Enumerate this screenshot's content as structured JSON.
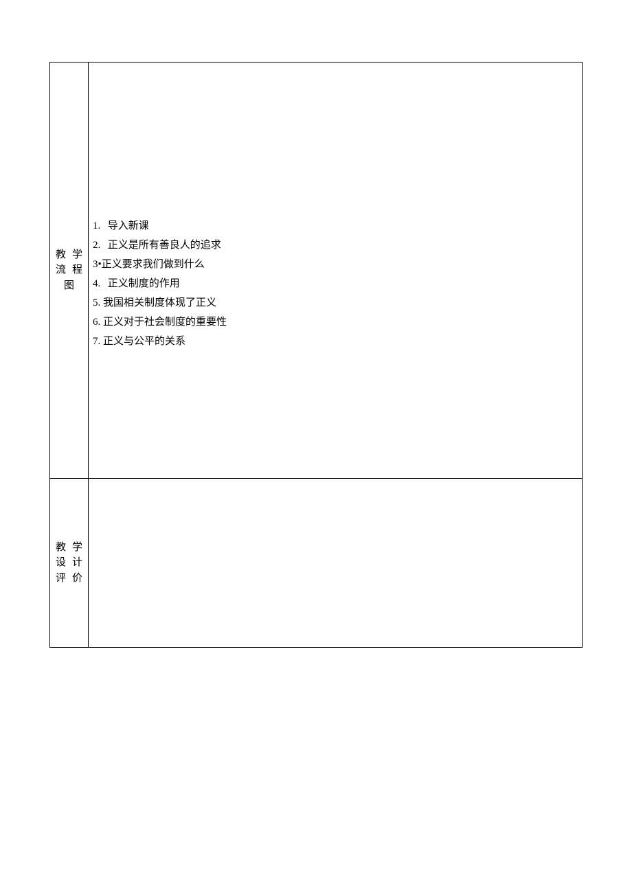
{
  "rows": [
    {
      "label": {
        "line1_a": "教",
        "line1_b": "学",
        "line2_a": "流",
        "line2_b": "程",
        "line3": "图"
      },
      "items": [
        {
          "num": "1.",
          "text": "导入新课",
          "padded": true
        },
        {
          "num": "2.",
          "text": "正义是所有善良人的追求",
          "padded": true
        },
        {
          "num": "3•",
          "text": "正义要求我们做到什么",
          "padded": false
        },
        {
          "num": "4.",
          "text": "正义制度的作用",
          "padded": true
        },
        {
          "num": "5.",
          "text": "我国相关制度体现了正义",
          "padded": false
        },
        {
          "num": "6.",
          "text": "正义对于社会制度的重要性",
          "padded": false
        },
        {
          "num": "7.",
          "text": "正义与公平的关系",
          "padded": false
        }
      ]
    },
    {
      "label": {
        "line1_a": "教",
        "line1_b": "学",
        "line2_a": "设",
        "line2_b": "计",
        "line3_a": "评",
        "line3_b": "价"
      }
    }
  ]
}
